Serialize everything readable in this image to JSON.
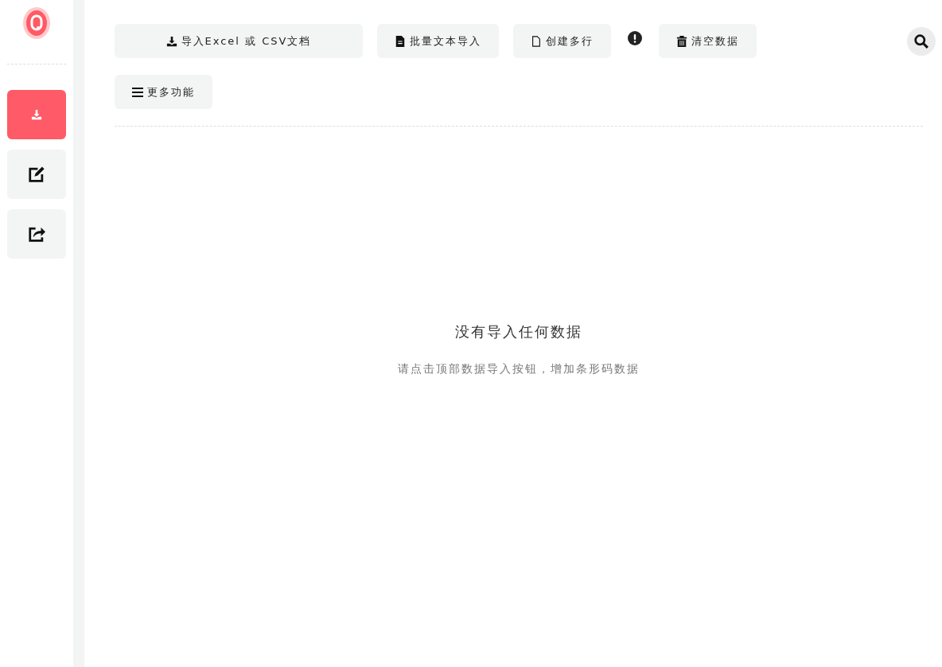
{
  "sidebar": {
    "items": [
      {
        "kind": "download",
        "selected": true
      },
      {
        "kind": "edit",
        "selected": false
      },
      {
        "kind": "share",
        "selected": false
      }
    ]
  },
  "toolbar": {
    "rows": [
      [
        {
          "kind": "download",
          "label": "导入Excel 或 CSV文档"
        },
        {
          "kind": "file",
          "label": "批量文本导入"
        },
        {
          "kind": "file-outline",
          "label": "创建多行"
        },
        {
          "kind": "info"
        },
        {
          "kind": "trash",
          "label": "清空数据"
        }
      ],
      [
        {
          "kind": "menu",
          "label": "更多功能"
        }
      ]
    ]
  },
  "empty_state": {
    "title": "没有导入任何数据",
    "subtitle": "请点击顶部数据导入按钮，增加条形码数据"
  }
}
